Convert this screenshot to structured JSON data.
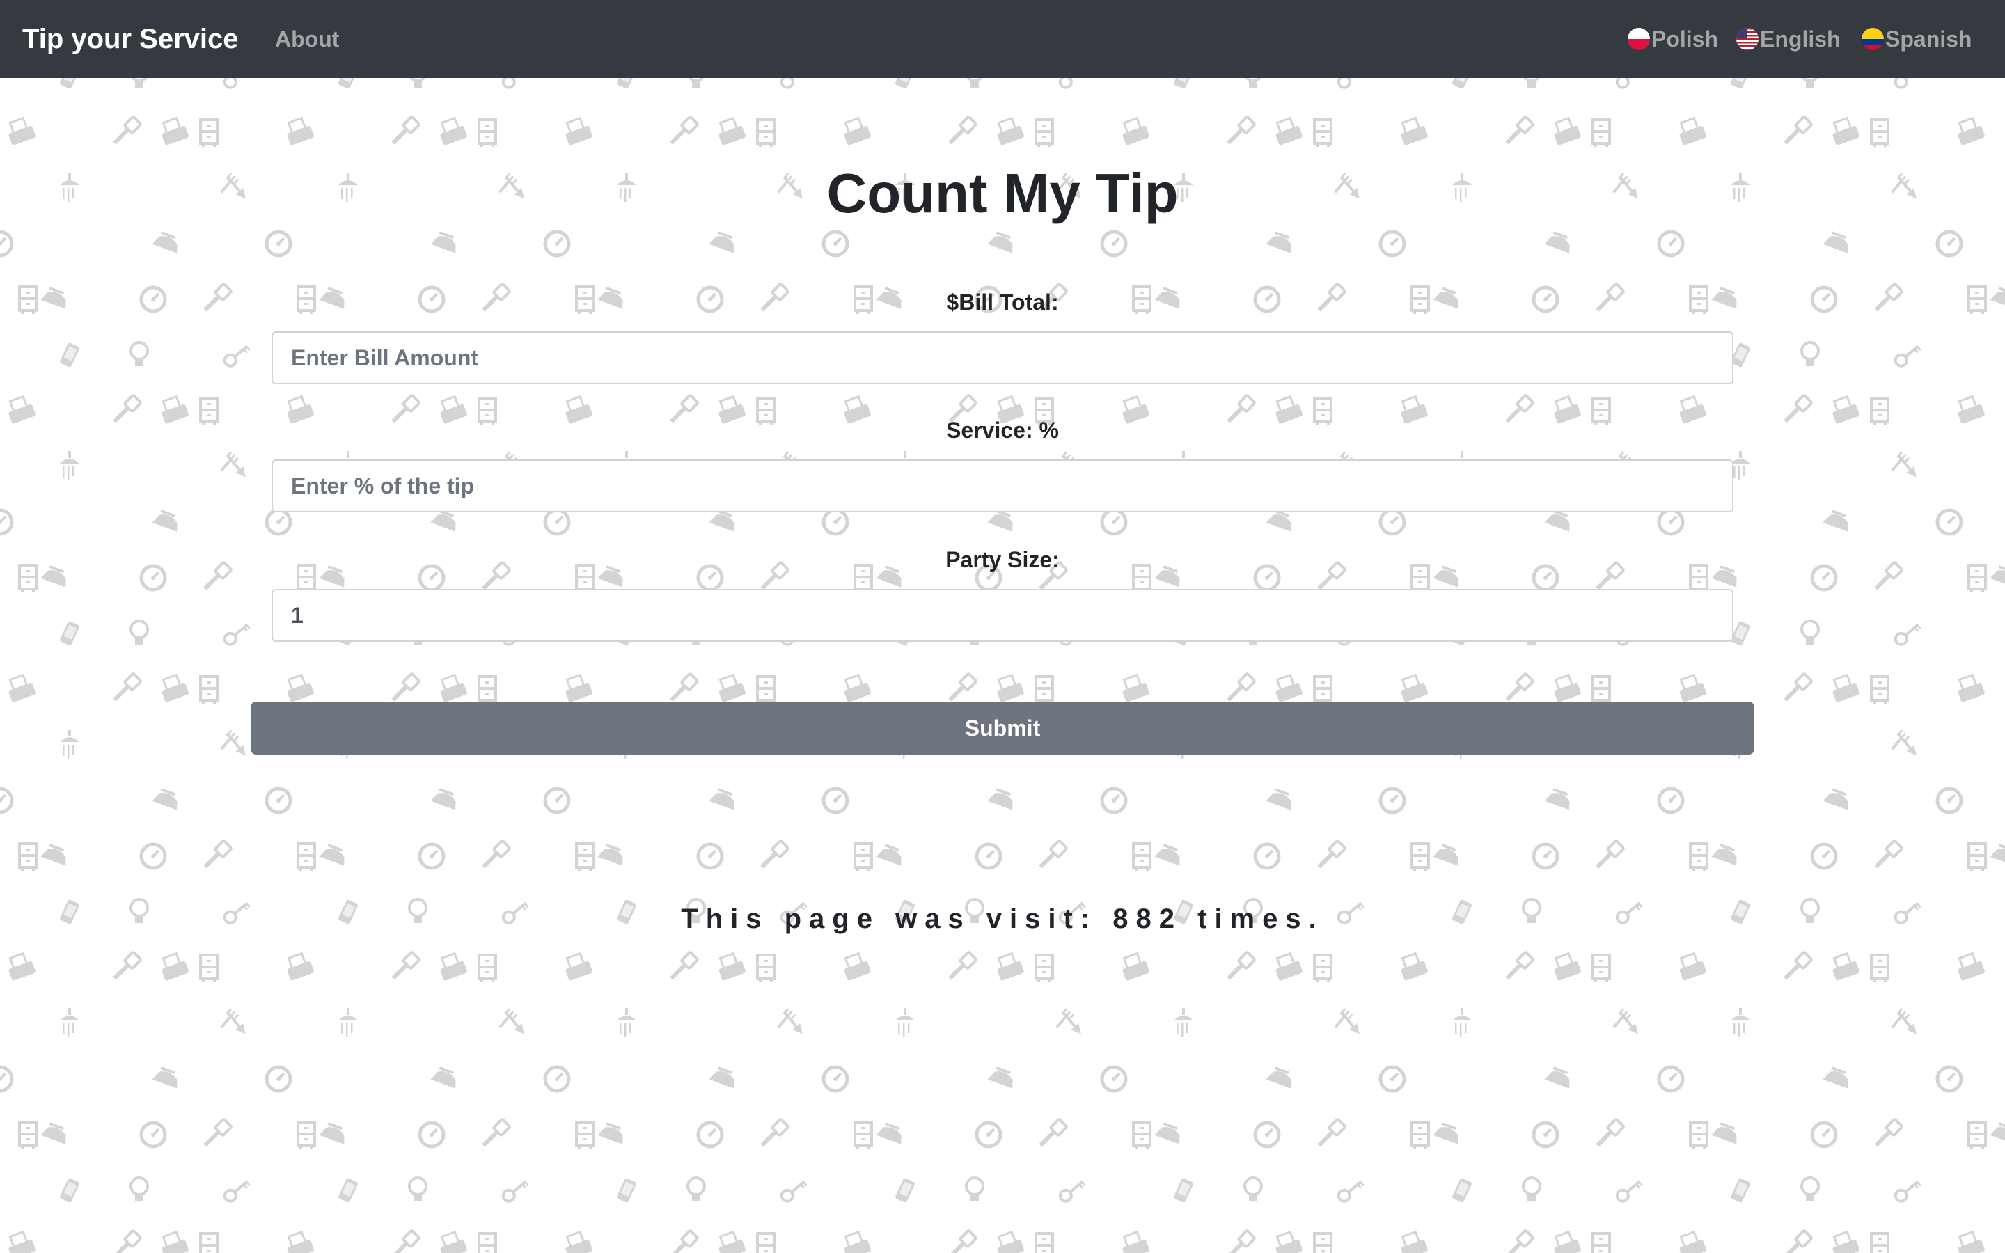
{
  "navbar": {
    "brand": "Tip your Service",
    "about": "About",
    "languages": [
      {
        "label": "Polish",
        "flag": "poland-flag-icon"
      },
      {
        "label": "English",
        "flag": "usa-flag-icon"
      },
      {
        "label": "Spanish",
        "flag": "colombia-flag-icon"
      }
    ]
  },
  "main": {
    "title": "Count My Tip",
    "bill": {
      "label": "$Bill Total:",
      "placeholder": "Enter Bill Amount",
      "value": ""
    },
    "service": {
      "label": "Service: %",
      "placeholder": "Enter % of the tip",
      "value": ""
    },
    "party": {
      "label": "Party Size:",
      "value": "1"
    },
    "submit_label": "Submit",
    "visits_text": "This page was visit: 882 times."
  },
  "background": {
    "pattern_icons": [
      "phone-icon",
      "lightbulb-icon",
      "key-icon",
      "printer-icon",
      "paintbrush-icon",
      "filing-cabinet-icon",
      "garden-tools-icon",
      "shower-icon",
      "iron-icon",
      "gauge-icon"
    ]
  },
  "colors": {
    "navbar": "#343a40",
    "submit": "#6c757d",
    "pattern_icon": "#d4d4d4"
  }
}
